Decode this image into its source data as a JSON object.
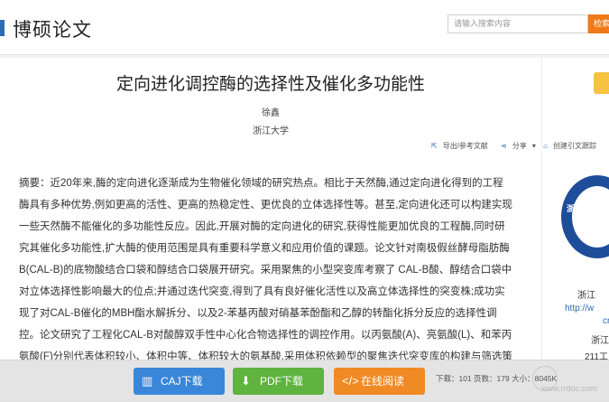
{
  "header": {
    "logo": "博硕论文",
    "search_placeholder": "请输入搜索内容",
    "search_button": "检索"
  },
  "paper": {
    "title": "定向进化调控酶的选择性及催化多功能性",
    "author": "徐鑫",
    "organization": "浙江大学"
  },
  "actions": [
    {
      "icon": "export-icon",
      "label": "导出/参考文献"
    },
    {
      "icon": "share-icon",
      "label": "分享"
    },
    {
      "icon": "citation-tracking-icon",
      "label": "创建引文跟踪"
    }
  ],
  "abstract_lines": [
    "摘要：近20年来,酶的定向进化逐渐成为生物催化领域的研究热点。相比于天然酶,通过定向进化得到的工程",
    "酶具有多种优势,例如更高的活性、更高的热稳定性、更优良的立体选择性等。甚至,定向进化还可以构建实现",
    "一些天然酶不能催化的多功能性反应。因此,开展对酶的定向进化的研究,获得性能更加优良的工程酶,同时研",
    "究其催化多功能性,扩大酶的使用范围是具有重要科学意义和应用价值的课题。论文针对南极假丝酵母脂肪酶",
    "B(CAL-B)的底物酸结合口袋和醇结合口袋展开研究。采用聚焦的小型突变库考察了 CAL-B酸、醇结合口袋中",
    "对立体选择性影响最大的位点;并通过迭代突变,得到了具有良好催化活性以及高立体选择性的突变株;成功实",
    "现了对CAL-B催化的MBH酯水解拆分、以及2-苯基丙酸对硝基苯酚酯和乙醇的转酯化拆分反应的选择性调",
    "控。论文研究了工程化CAL-B对酸醇双手性中心化合物选择性的调控作用。以丙氨酸(A)、亮氨酸(L)、和苯丙",
    "氨酸(F)分别代表体积较小、体积中等、体积较大的氨基酸,采用体积依赖型的聚焦迭代突变库的构建与筛选策"
  ],
  "sidebar": {
    "emblem_text": "浙江大学",
    "school": "浙江",
    "url": "http://w",
    "url_tail": "cn",
    "line3": "浙江",
    "line4": "211工"
  },
  "bottom": {
    "caj_label": "CAJ下载",
    "pdf_label": "PDF下载",
    "read_label": "在线阅读",
    "stats": "下载：101  页数：179  大小：8045K",
    "watermark": "www.rrdoc.com"
  },
  "colors": {
    "brand": "#2f6bb3",
    "search_button": "#f07a1a",
    "caj": "#3a86d8",
    "pdf": "#5fb33f",
    "read": "#f08a24"
  }
}
